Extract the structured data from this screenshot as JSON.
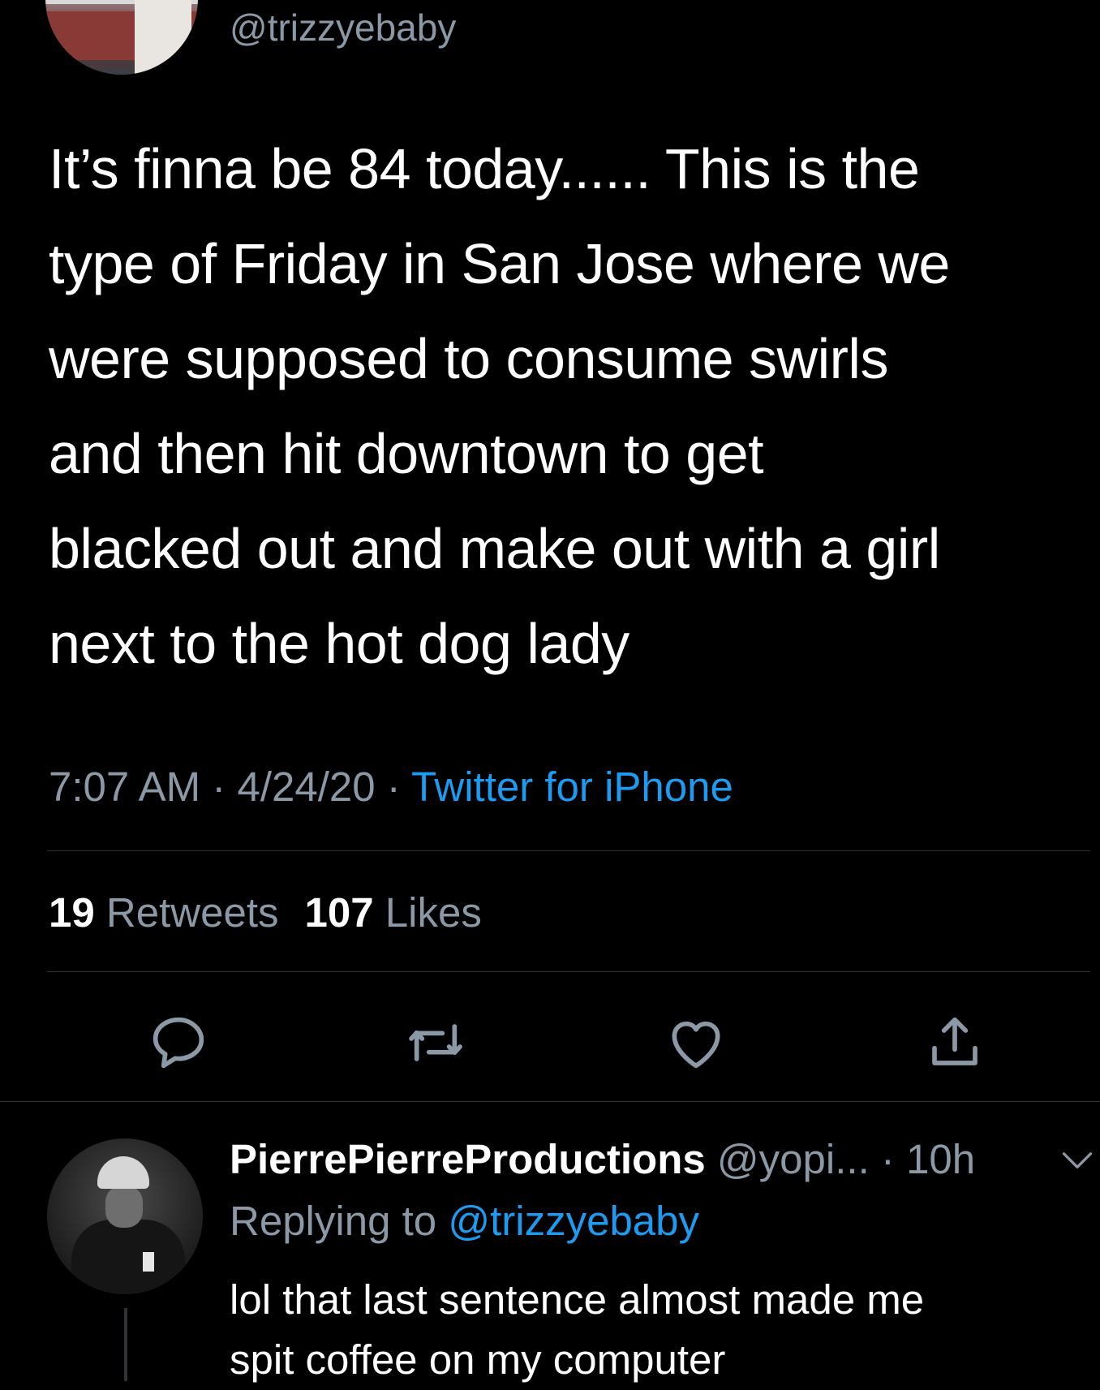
{
  "tweet": {
    "handle": "@trizzyebaby",
    "text_lines": [
      "It’s finna be 84 today...... This is the",
      "type of Friday in San Jose where we",
      "were supposed to consume swirls",
      "and then hit downtown to get",
      "blacked out and make out with a girl",
      "next to the hot dog lady"
    ],
    "time": "7:07 AM",
    "separator": " · ",
    "date": "4/24/20",
    "source": "Twitter for iPhone",
    "retweets_count": "19",
    "retweets_label": "Retweets",
    "likes_count": "107",
    "likes_label": "Likes"
  },
  "actions": [
    {
      "icon": "reply-icon"
    },
    {
      "icon": "retweet-icon"
    },
    {
      "icon": "like-icon"
    },
    {
      "icon": "share-icon"
    }
  ],
  "reply": {
    "name": "PierrePierreProductions",
    "handle": " @yopi...",
    "time": " · 10h",
    "replying_prefix": "Replying to ",
    "replying_to": "@trizzyebaby",
    "text_lines": [
      "lol that last sentence almost made me",
      "spit coffee on my computer"
    ]
  },
  "colors": {
    "background": "#000000",
    "text": "#ffffff",
    "secondary": "#8b98a5",
    "accent": "#1d9bf0",
    "divider": "#2f3336"
  }
}
